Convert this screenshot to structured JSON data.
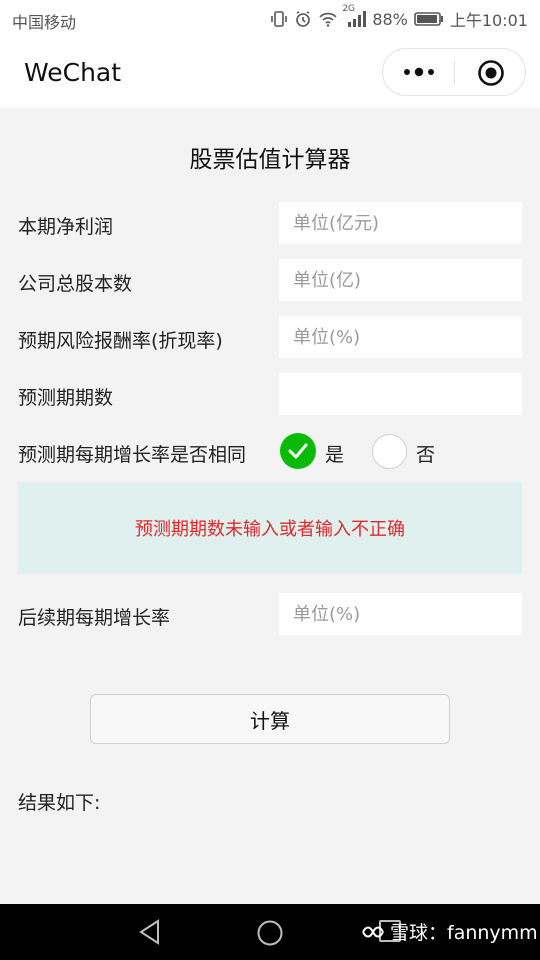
{
  "status_bar": {
    "carrier": "中国移动",
    "network": "2G",
    "battery": "88%",
    "time": "上午10:01"
  },
  "titlebar": {
    "app_name": "WeChat",
    "icons": [
      "more-icon",
      "close-target-icon"
    ]
  },
  "form": {
    "title": "股票估值计算器",
    "fields": [
      {
        "label": "本期净利润",
        "placeholder": "单位(亿元)",
        "value": ""
      },
      {
        "label": "公司总股本数",
        "placeholder": "单位(亿)",
        "value": ""
      },
      {
        "label": "预期风险报酬率(折现率)",
        "placeholder": "单位(%)",
        "value": ""
      },
      {
        "label": "预测期期数",
        "placeholder": "",
        "value": ""
      }
    ],
    "same_rate": {
      "label": "预测期每期增长率是否相同",
      "option_yes": "是",
      "option_no": "否",
      "selected": "是"
    },
    "error_message": "预测期期数未输入或者输入不正确",
    "later_rate": {
      "label": "后续期每期增长率",
      "placeholder": "单位(%)",
      "value": ""
    },
    "calculate_button": "计算",
    "result_label": "结果如下:"
  },
  "colors": {
    "accent_green": "#09bb07",
    "error_red": "#e0292c",
    "error_background": "#dff0ee"
  },
  "watermark": {
    "text": "雪球：fannymm"
  }
}
